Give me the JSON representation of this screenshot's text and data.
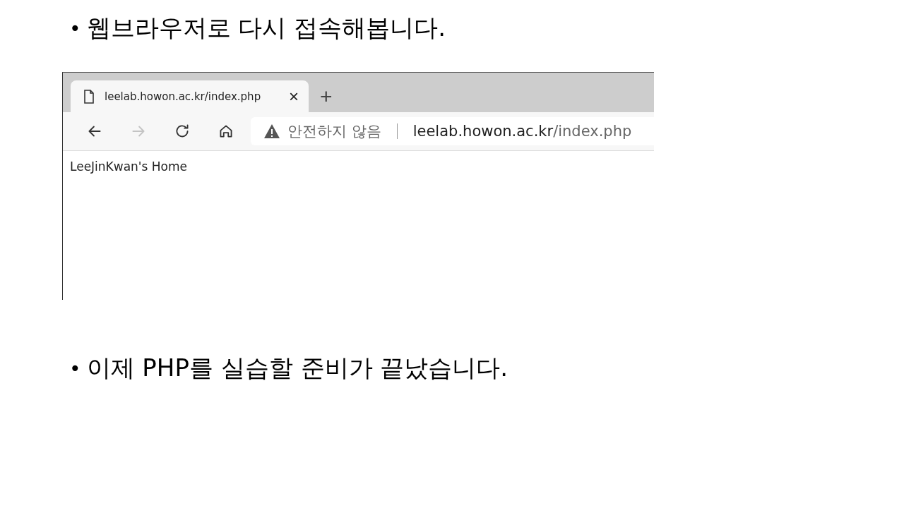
{
  "bullets": [
    {
      "bullet": "•",
      "text": "웹브라우저로 다시 접속해봅니다."
    },
    {
      "bullet": "•",
      "text": "이제 PHP를 실습할 준비가 끝났습니다."
    }
  ],
  "browser": {
    "tabs": [
      {
        "title": "leelab.howon.ac.kr/index.php",
        "selected": true,
        "close": "×"
      }
    ],
    "new_tab": "+",
    "nav": [
      {
        "kind": "back",
        "disabled": false
      },
      {
        "kind": "forward",
        "disabled": true
      },
      {
        "kind": "reload",
        "disabled": false
      },
      {
        "kind": "home",
        "disabled": false
      }
    ],
    "address": {
      "security": "안전하지 않음",
      "host": "leelab.howon.ac.kr",
      "path": "/index.php"
    },
    "page_text": "LeeJinKwan's Home"
  }
}
